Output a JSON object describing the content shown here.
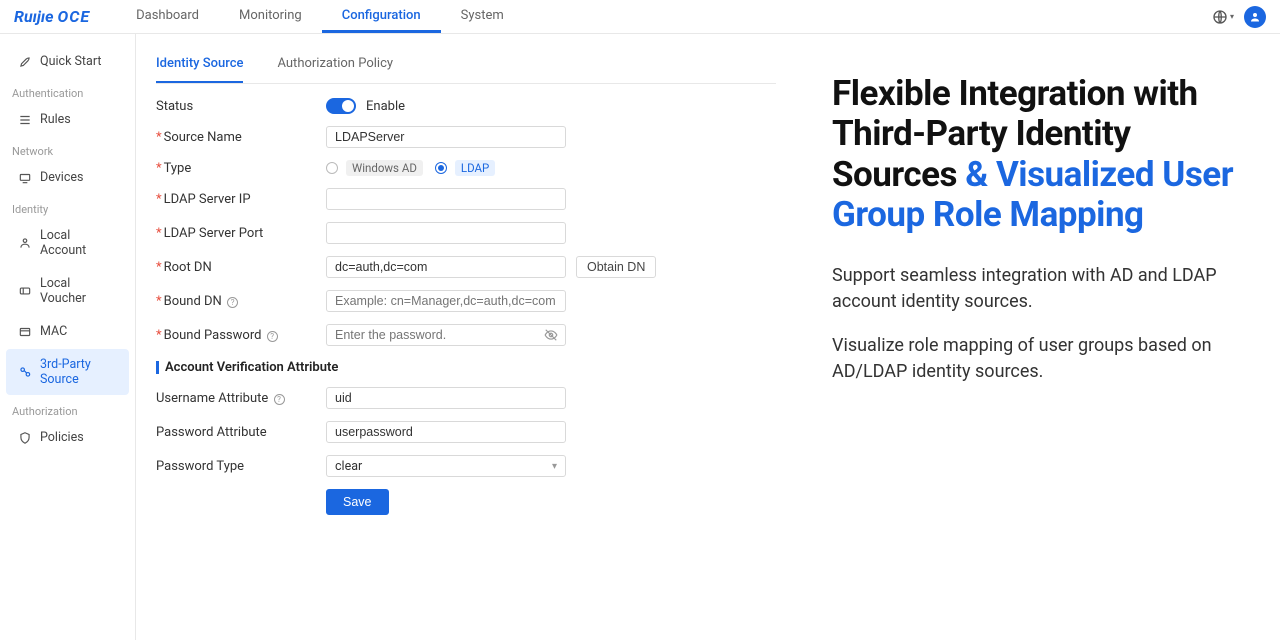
{
  "brand": {
    "prefix": "Ruıjıe",
    "suffix": "OCE"
  },
  "nav": {
    "items": [
      {
        "label": "Dashboard"
      },
      {
        "label": "Monitoring"
      },
      {
        "label": "Configuration"
      },
      {
        "label": "System"
      }
    ],
    "activeIndex": 2
  },
  "sidebar": {
    "groups": [
      {
        "label": null,
        "items": [
          {
            "label": "Quick Start",
            "icon": "rocket"
          }
        ]
      },
      {
        "label": "Authentication",
        "items": [
          {
            "label": "Rules",
            "icon": "list"
          }
        ]
      },
      {
        "label": "Network",
        "items": [
          {
            "label": "Devices",
            "icon": "device"
          }
        ]
      },
      {
        "label": "Identity",
        "items": [
          {
            "label": "Local Account",
            "icon": "user"
          },
          {
            "label": "Local Voucher",
            "icon": "ticket"
          },
          {
            "label": "MAC",
            "icon": "card"
          },
          {
            "label": "3rd-Party Source",
            "icon": "org",
            "active": true
          }
        ]
      },
      {
        "label": "Authorization",
        "items": [
          {
            "label": "Policies",
            "icon": "shield"
          }
        ]
      }
    ]
  },
  "tabs": {
    "items": [
      {
        "label": "Identity Source"
      },
      {
        "label": "Authorization Policy"
      }
    ],
    "activeIndex": 0
  },
  "form": {
    "status": {
      "label": "Status",
      "enabled": true,
      "enabledLabel": "Enable"
    },
    "sourceName": {
      "label": "Source Name",
      "value": "LDAPServer"
    },
    "type": {
      "label": "Type",
      "options": [
        {
          "label": "Windows AD"
        },
        {
          "label": "LDAP"
        }
      ],
      "selected": 1
    },
    "ldapIp": {
      "label": "LDAP Server IP",
      "value": ""
    },
    "ldapPort": {
      "label": "LDAP Server Port",
      "value": ""
    },
    "rootDN": {
      "label": "Root DN",
      "value": "dc=auth,dc=com",
      "obtain": "Obtain DN"
    },
    "boundDN": {
      "label": "Bound DN",
      "value": "",
      "placeholder": "Example: cn=Manager,dc=auth,dc=com"
    },
    "boundPw": {
      "label": "Bound Password",
      "value": "",
      "placeholder": "Enter the password."
    },
    "section": "Account Verification Attribute",
    "userAttr": {
      "label": "Username Attribute",
      "value": "uid"
    },
    "pwAttr": {
      "label": "Password Attribute",
      "value": "userpassword"
    },
    "pwType": {
      "label": "Password Type",
      "value": "clear"
    },
    "save": "Save"
  },
  "hero": {
    "h1": {
      "pre": "Flexible Integration with Third-Party Identity Sources",
      "amp": " & ",
      "post": "Visualized User Group Role Mapping"
    },
    "p1": "Support seamless integration with AD and LDAP account identity sources.",
    "p2": "Visualize role mapping of user groups based on AD/LDAP identity sources."
  }
}
